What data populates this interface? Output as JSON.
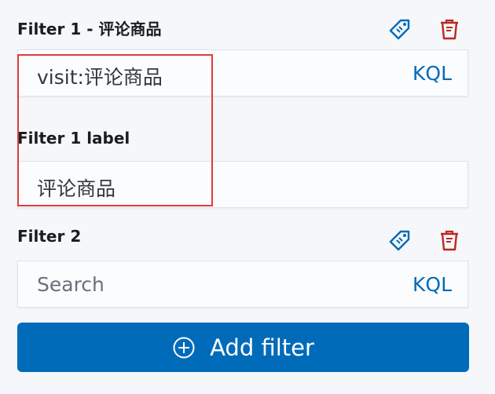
{
  "filters": [
    {
      "title": "Filter 1 - 评论商品",
      "query_value": "visit:评论商品",
      "query_mode": "KQL",
      "label_field_title": "Filter 1 label",
      "label_value": "评论商品",
      "label_icon": "tag-icon",
      "delete_icon": "trash-icon"
    },
    {
      "title": "Filter 2",
      "query_placeholder": "Search",
      "query_mode": "KQL",
      "label_icon": "tag-icon",
      "delete_icon": "trash-icon"
    }
  ],
  "add_button": {
    "label": "Add filter",
    "icon": "plus-circle-icon"
  },
  "colors": {
    "accent": "#006bb8",
    "delete": "#bd271e",
    "highlight_box": "#e23b3b",
    "text": "#1a1c21"
  }
}
